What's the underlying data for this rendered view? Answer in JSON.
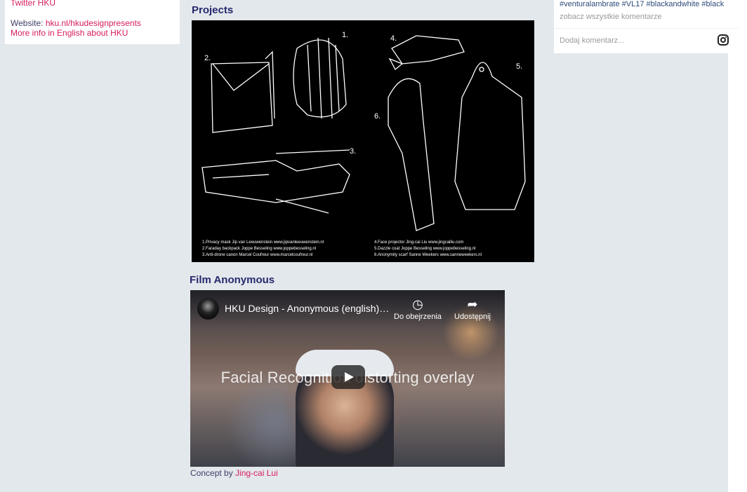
{
  "sidebar_card": {
    "twitter_link": "Twitter HKU",
    "website_label": "Website: ",
    "website_link": "hku.nl/hkudesignpresents",
    "more_info_link": "More info in English about HKU"
  },
  "projects": {
    "title": "Projects",
    "image_numbers": [
      "1.",
      "2.",
      "3.",
      "4.",
      "5.",
      "6."
    ],
    "captions_left": [
      "1.Privacy mask Jip van Leeuwenstein www.jipvanleeuwenstein.nl",
      "2.Faraday backpack Joppe Besseling www.joppebesseling.nl",
      "3.Anti-drone canon Marcel Coufreur www.marcelcoufreur.nl"
    ],
    "captions_right": [
      "4.Face projector Jing-cai Liu www.jingcailiu.com",
      "5.Dazzle coat Joppe Besseling www.joppebesseling.nl",
      "6.Anonymity scarf Sanne Weekers www.sanneweekers.nl"
    ]
  },
  "film": {
    "title": "Film Anonymous",
    "video_title": "HKU Design - Anonymous (english)…",
    "watch_later": "Do obejrzenia",
    "share": "Udostępnij",
    "overlay_text": "Facial Recognition distorting overlay",
    "concept_label": "Concept by ",
    "concept_author": "Jing-cai Lui"
  },
  "instagram": {
    "hashtags": "#venturalambrate #VL17 #blackandwhite #black",
    "view_all_comments": "zobacz wszystkie komentarze",
    "add_comment_placeholder": "Dodaj komentarz...",
    "icon": "instagram-icon"
  }
}
